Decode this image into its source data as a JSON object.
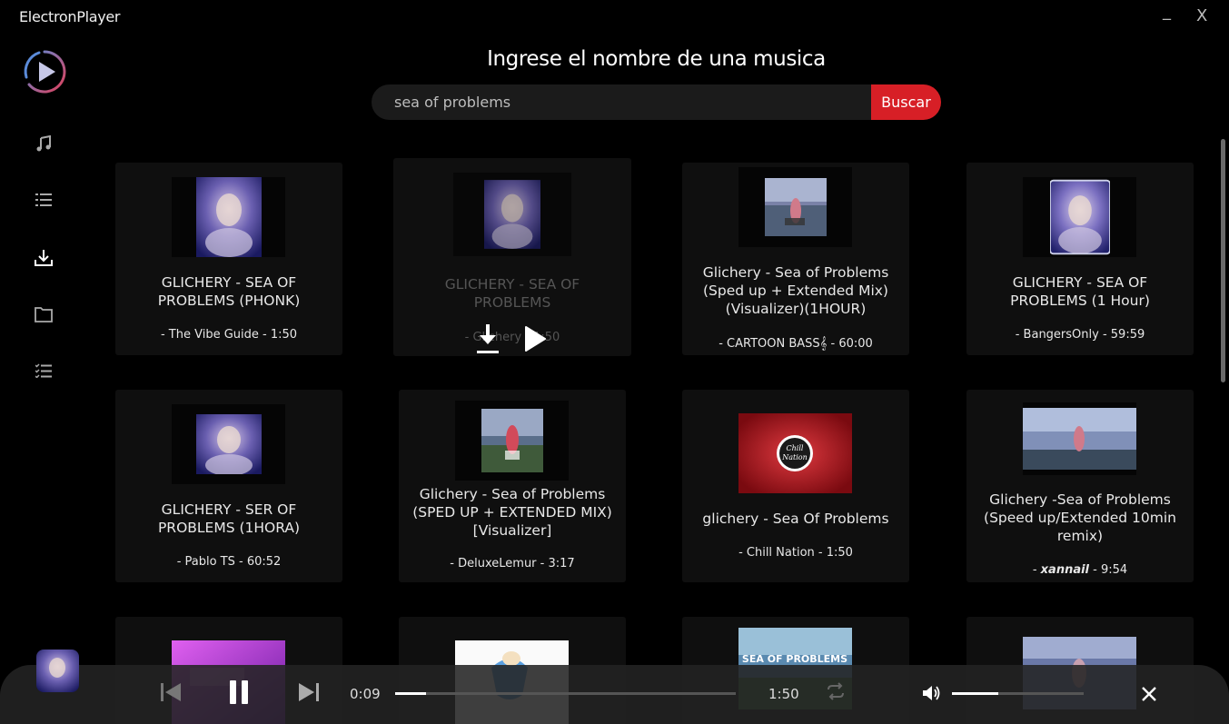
{
  "app": {
    "title": "ElectronPlayer",
    "minimize": "_",
    "close": "X"
  },
  "header": {
    "title": "Ingrese el nombre de una musica"
  },
  "search": {
    "value": "sea of problems",
    "button": "Buscar"
  },
  "results": [
    {
      "title": "GLICHERY - SEA OF PROBLEMS (PHONK)",
      "meta": "- The Vibe Guide - 1:50",
      "thumb": "portrait-art"
    },
    {
      "title": "GLICHERY - SEA OF PROBLEMS",
      "meta": "- Glichery - 1:50",
      "thumb": "portrait-art"
    },
    {
      "title": "Glichery - Sea of Problems (Sped up + Extended Mix) (Visualizer)(1HOUR)",
      "meta": "- CARTOON BASS𝄞 - 60:00",
      "thumb": "field-scene"
    },
    {
      "title": "GLICHERY - SEA OF PROBLEMS (1 Hour)",
      "meta": "- BangersOnly - 59:59",
      "thumb": "portrait-art"
    },
    {
      "title": "GLICHERY - SER OF PROBLEMS (1HORA)",
      "meta": "- Pablo TS - 60:52",
      "thumb": "portrait-art"
    },
    {
      "title": "Glichery - Sea of Problems (SPED UP + EXTENDED MIX) [Visualizer]",
      "meta": "- DeluxeLemur - 3:17",
      "thumb": "field-scene"
    },
    {
      "title": "glichery - Sea Of Problems",
      "meta": "- Chill Nation - 1:50",
      "thumb": "chill-nation"
    },
    {
      "title": "Glichery -Sea of Problems (Speed up/Extended 10min remix)",
      "meta_prefix": "- ",
      "meta_channel": "xannail",
      "meta_duration": " - 9:54",
      "thumb": "field-scene"
    }
  ],
  "row3_thumb_text": "SEA OF PROBLEMS",
  "player": {
    "current": "0:09",
    "duration": "1:50",
    "progress": 0.09,
    "volume": 0.35
  },
  "colors": {
    "accent": "#d71f26",
    "background": "#000000",
    "card": "#0f0f0f",
    "player_bar": "#232323"
  },
  "icons": [
    "play-logo-icon",
    "music-note-icon",
    "list-icon",
    "download-icon",
    "folder-icon",
    "checklist-icon",
    "download-icon",
    "play-icon",
    "previous-icon",
    "pause-icon",
    "next-icon",
    "repeat-icon",
    "volume-icon",
    "close-icon"
  ]
}
